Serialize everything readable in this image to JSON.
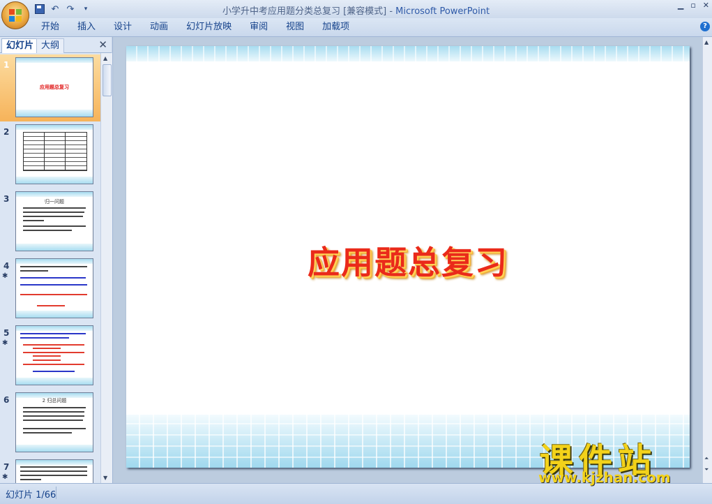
{
  "window": {
    "title_doc": "小学升中考应用题分类总复习 [兼容模式] - ",
    "title_app": "Microsoft PowerPoint"
  },
  "ribbon": {
    "tabs": [
      "开始",
      "插入",
      "设计",
      "动画",
      "幻灯片放映",
      "审阅",
      "视图",
      "加载项"
    ],
    "help": "?"
  },
  "left_pane": {
    "tab_slides": "幻灯片",
    "tab_outline": "大纲",
    "close": "✕"
  },
  "thumbnails": [
    {
      "num": "1",
      "title": "应用题总复习"
    },
    {
      "num": "2"
    },
    {
      "num": "3",
      "heading": "归一问题"
    },
    {
      "num": "4"
    },
    {
      "num": "5"
    },
    {
      "num": "6",
      "heading": "2 归总问题"
    },
    {
      "num": "7"
    }
  ],
  "slide": {
    "title": "应用题总复习"
  },
  "status": {
    "text": "幻灯片 1/66"
  },
  "watermark": {
    "brand": "课件站",
    "url": "www.kjzhan.com"
  }
}
